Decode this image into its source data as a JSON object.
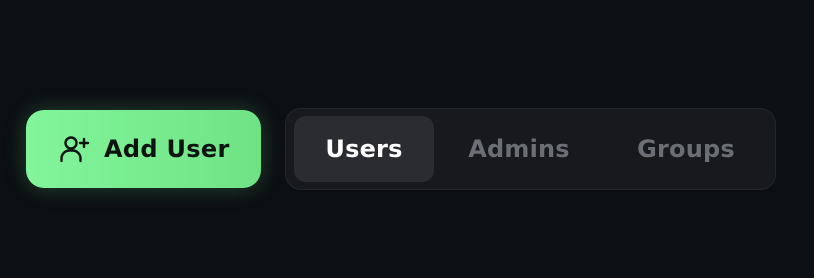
{
  "add_user_button": {
    "label": "Add User",
    "icon": "user-plus-icon"
  },
  "tabs": [
    {
      "label": "Users",
      "active": true
    },
    {
      "label": "Admins",
      "active": false
    },
    {
      "label": "Groups",
      "active": false
    }
  ],
  "colors": {
    "background": "#0c0f13",
    "accent": "#7aee92",
    "tab_bar_bg": "#17191d",
    "active_tab_bg": "#2a2c32",
    "active_tab_text": "#ffffff",
    "inactive_tab_text": "#6b6e74"
  }
}
